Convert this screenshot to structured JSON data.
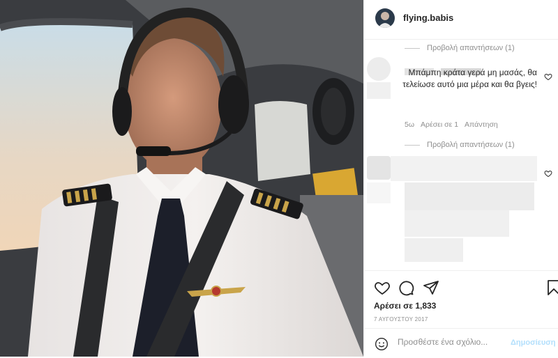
{
  "post": {
    "username": "flying.babis",
    "likes_text": "Αρέσει σε 1,833",
    "date_text": "7 ΑΥΓΟΥΣΤΟΥ 2017"
  },
  "comments": {
    "view_replies_1": "Προβολή απαντήσεων (1)",
    "comment_text": "Μπάμπη κράτα γερά μη μασάς, θα τελείωσε αυτό μια μέρα και θα βγεις!",
    "comment_age": "5ω",
    "comment_likes": "Αρέσει σε 1",
    "reply_label": "Απάντηση",
    "view_replies_2": "Προβολή απαντήσεων (1)"
  },
  "composer": {
    "placeholder": "Προσθέστε ένα σχόλιο...",
    "post_label": "Δημοσίευση"
  },
  "icons": [
    "heart-icon",
    "comment-icon",
    "share-icon",
    "bookmark-icon",
    "smiley-icon"
  ],
  "colors": {
    "text": "#262626",
    "secondary": "#8e8e8e",
    "post_button_disabled": "#b2dffc",
    "divider": "#efefef"
  }
}
